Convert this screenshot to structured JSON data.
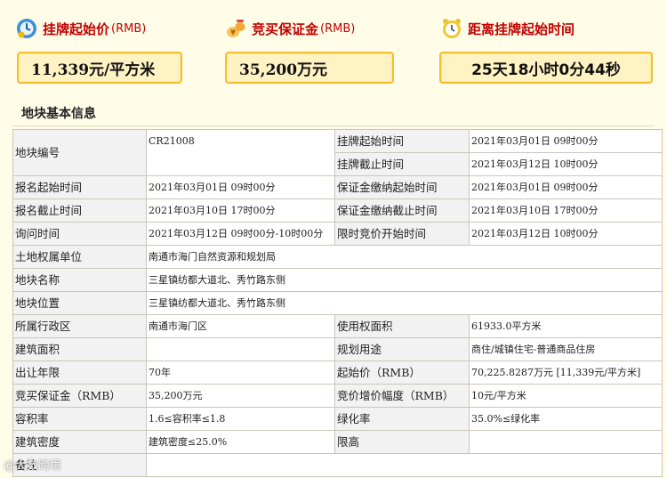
{
  "cards": {
    "start_price": {
      "title": "挂牌起始价",
      "unit": "(RMB)",
      "value": "11,339元/平方米"
    },
    "deposit": {
      "title": "竞买保证金",
      "unit": "(RMB)",
      "value": "35,200万元"
    },
    "countdown": {
      "title": "距离挂牌起始时间",
      "value": "25天18小时0分44秒"
    }
  },
  "section_title": "地块基本信息",
  "table": {
    "r1": {
      "l1": "地块编号",
      "v1": "CR21008",
      "l2a": "挂牌起始时间",
      "v2a": "2021年03月01日 09时00分",
      "l2b": "挂牌截止时间",
      "v2b": "2021年03月12日 10时00分"
    },
    "r3": {
      "l1": "报名起始时间",
      "v1": "2021年03月01日 09时00分",
      "l2": "保证金缴纳起始时间",
      "v2": "2021年03月01日 09时00分"
    },
    "r4": {
      "l1": "报名截止时间",
      "v1": "2021年03月10日 17时00分",
      "l2": "保证金缴纳截止时间",
      "v2": "2021年03月10日 17时00分"
    },
    "r5": {
      "l1": "询问时间",
      "v1": "2021年03月12日 09时00分-10时00分",
      "l2": "限时竞价开始时间",
      "v2": "2021年03月12日 10时00分"
    },
    "r6": {
      "l1": "土地权属单位",
      "v1": "南通市海门自然资源和规划局"
    },
    "r7": {
      "l1": "地块名称",
      "v1": "三星镇纺都大道北、秀竹路东侧"
    },
    "r8": {
      "l1": "地块位置",
      "v1": "三星镇纺都大道北、秀竹路东侧"
    },
    "r9": {
      "l1": "所属行政区",
      "v1": "南通市海门区",
      "l2": "使用权面积",
      "v2": "61933.0平方米"
    },
    "r10": {
      "l1": "建筑面积",
      "v1": "",
      "l2": "规划用途",
      "v2": "商住/城镇住宅-普通商品住房"
    },
    "r11": {
      "l1": "出让年限",
      "v1": "70年",
      "l2": "起始价（RMB）",
      "v2": "70,225.8287万元 [11,339元/平方米]"
    },
    "r12": {
      "l1": "竞买保证金（RMB）",
      "v1": "35,200万元",
      "l2": "竞价增价幅度（RMB）",
      "v2": "10元/平方米"
    },
    "r13": {
      "l1": "容积率",
      "v1": "1.6≤容积率≤1.8",
      "l2": "绿化率",
      "v2": "35.0%≤绿化率"
    },
    "r14": {
      "l1": "建筑密度",
      "v1": "建筑密度≤25.0%",
      "l2": "限高",
      "v2": ""
    },
    "r15": {
      "l1": "备注",
      "v1": ""
    }
  },
  "watermark": "@大数跨境",
  "icons": {
    "price": "price-tag-icon",
    "deposit": "money-bag-icon",
    "timer": "alarm-clock-icon"
  }
}
